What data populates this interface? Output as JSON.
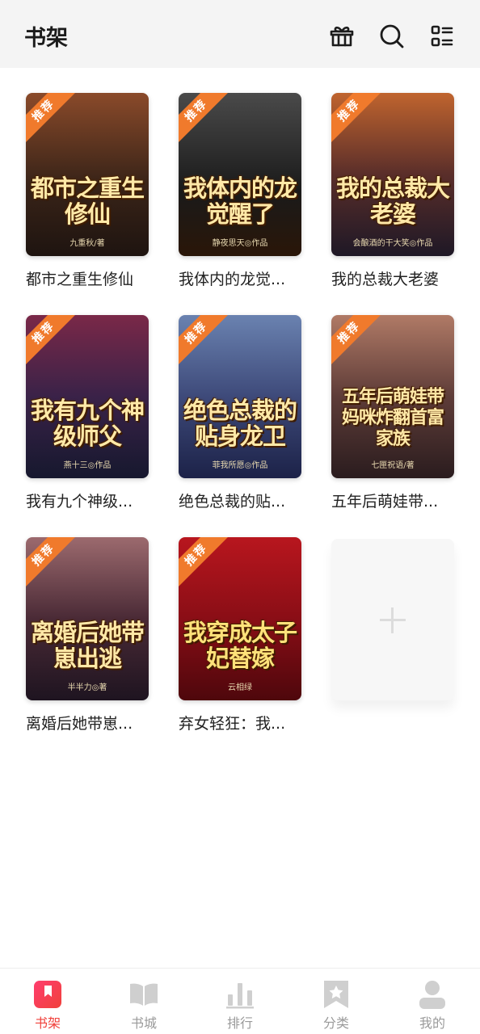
{
  "header": {
    "title": "书架",
    "icons": [
      "gift-icon",
      "search-icon",
      "grid-list-icon"
    ]
  },
  "books": [
    {
      "title": "都市之重生修仙",
      "badge": "推荐",
      "cover_title": "都市之重生修仙",
      "cover_author": "九重秋/著",
      "colors": [
        "#7a3a1e",
        "#2a1d1a"
      ]
    },
    {
      "title": "我体内的龙觉...",
      "badge": "推荐",
      "cover_title": "我体内的龙觉醒了",
      "cover_author": "静夜思天◎作品",
      "colors": [
        "#3c3c3c",
        "#0d0d0d"
      ]
    },
    {
      "title": "我的总裁大老婆",
      "badge": "推荐",
      "cover_title": "我的总裁大老婆",
      "cover_author": "会酿酒的干大笑◎作品",
      "colors": [
        "#b65a2a",
        "#241a28"
      ]
    },
    {
      "title": "我有九个神级...",
      "badge": "推荐",
      "cover_title": "我有九个神级师父",
      "cover_author": "燕十三◎作品",
      "colors": [
        "#6a2440",
        "#1e1f3a"
      ]
    },
    {
      "title": "绝色总裁的贴...",
      "badge": "推荐",
      "cover_title": "绝色总裁的贴身龙卫",
      "cover_author": "菲我所愿◎作品",
      "colors": [
        "#5a6f9a",
        "#2a2f55"
      ]
    },
    {
      "title": "五年后萌娃带...",
      "badge": "推荐",
      "cover_title": "五年后萌娃带妈咪炸翻首富家族",
      "cover_author": "七匣祝语/著",
      "colors": [
        "#9a6a5a",
        "#3a2a2a"
      ]
    },
    {
      "title": "离婚后她带崽...",
      "badge": "推荐",
      "cover_title": "离婚后她带崽出逃",
      "cover_author": "半半力◎著",
      "colors": [
        "#8c5a62",
        "#3a2330"
      ]
    },
    {
      "title": "弃女轻狂：我...",
      "badge": "推荐",
      "cover_title": "我穿成太子妃替嫁",
      "cover_author": "云相绿",
      "colors": [
        "#a8141c",
        "#5a0a10"
      ]
    }
  ],
  "add_card": {
    "icon": "plus-icon"
  },
  "tabs": [
    {
      "label": "书架",
      "icon": "bookshelf-icon",
      "active": true
    },
    {
      "label": "书城",
      "icon": "open-book-icon",
      "active": false
    },
    {
      "label": "排行",
      "icon": "bar-chart-icon",
      "active": false
    },
    {
      "label": "分类",
      "icon": "bookmark-star-icon",
      "active": false
    },
    {
      "label": "我的",
      "icon": "profile-icon",
      "active": false
    }
  ],
  "colors": {
    "accent": "#f0413b",
    "badge": "#f07a2c",
    "tab_inactive": "#cfcfcf"
  }
}
